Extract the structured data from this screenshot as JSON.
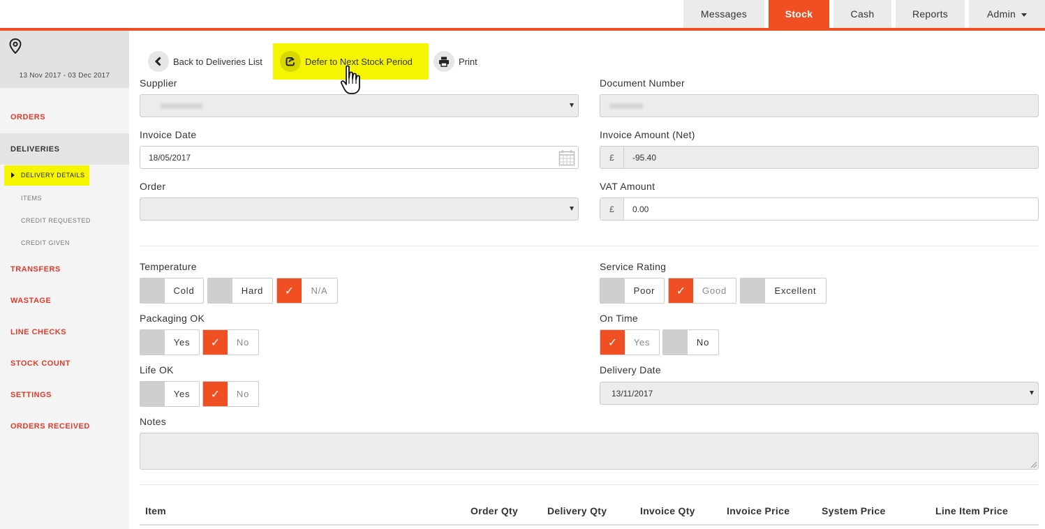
{
  "nav": {
    "tabs": [
      {
        "label": "Messages"
      },
      {
        "label": "Stock"
      },
      {
        "label": "Cash"
      },
      {
        "label": "Reports"
      },
      {
        "label": "Admin"
      }
    ]
  },
  "sidebar": {
    "date_range": "13 Nov 2017 - 03 Dec 2017",
    "items": [
      "ORDERS",
      "DELIVERIES",
      "TRANSFERS",
      "WASTAGE",
      "LINE CHECKS",
      "STOCK COUNT",
      "SETTINGS",
      "ORDERS RECEIVED"
    ],
    "sub_items": [
      "DELIVERY DETAILS",
      "ITEMS",
      "CREDIT REQUESTED",
      "CREDIT GIVEN"
    ]
  },
  "actions": {
    "back": "Back to Deliveries List",
    "defer": "Defer to Next Stock Period",
    "print": "Print"
  },
  "form": {
    "supplier_label": "Supplier",
    "document_number_label": "Document Number",
    "invoice_date_label": "Invoice Date",
    "invoice_date_value": "18/05/2017",
    "invoice_amount_label": "Invoice Amount (Net)",
    "currency": "£",
    "invoice_amount_value": "-95.40",
    "order_label": "Order",
    "vat_label": "VAT Amount",
    "vat_value": "0.00",
    "temperature_label": "Temperature",
    "temperature_options": [
      "Cold",
      "Hard",
      "N/A"
    ],
    "service_label": "Service Rating",
    "service_options": [
      "Poor",
      "Good",
      "Excellent"
    ],
    "packaging_label": "Packaging OK",
    "on_time_label": "On Time",
    "life_label": "Life OK",
    "yes": "Yes",
    "no": "No",
    "delivery_date_label": "Delivery Date",
    "delivery_date_value": "13/11/2017",
    "notes_label": "Notes",
    "check": "✓"
  },
  "table": {
    "headers": [
      "Item",
      "Order Qty",
      "Delivery Qty",
      "Invoice Qty",
      "Invoice Price",
      "System Price",
      "Line Item Price"
    ]
  },
  "colors": {
    "accent": "#f04e23",
    "highlight": "#f5f500",
    "sidebar_link": "#e23a2b"
  }
}
